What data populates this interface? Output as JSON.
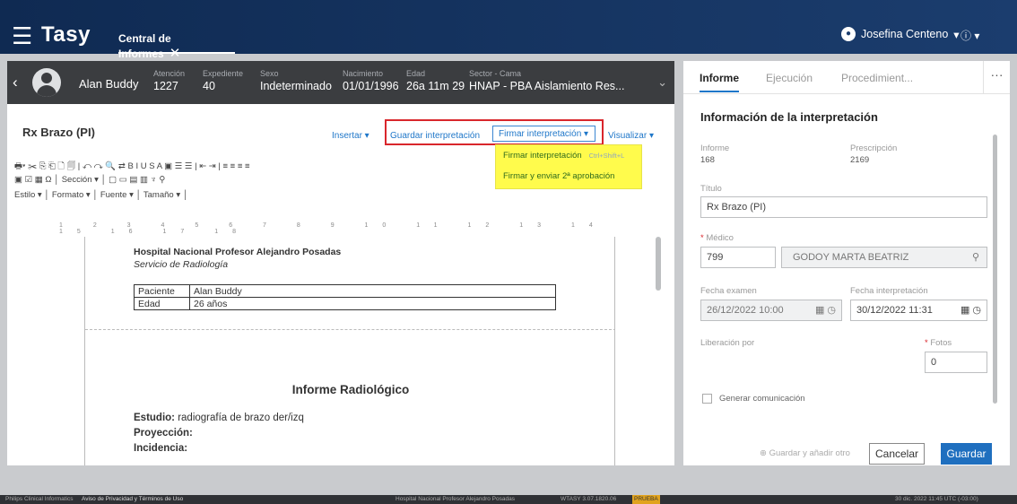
{
  "app": {
    "title": "Tasy",
    "tab": "Central de Informes"
  },
  "user": {
    "name": "Josefina Centeno"
  },
  "patient": {
    "name": "Alan Buddy",
    "fields": [
      {
        "label": "Atención",
        "value": "1227"
      },
      {
        "label": "Expediente",
        "value": "40"
      },
      {
        "label": "Sexo",
        "value": "Indeterminado"
      },
      {
        "label": "Nacimiento",
        "value": "01/01/1996"
      },
      {
        "label": "Edad",
        "value": "26a 11m 29"
      },
      {
        "label": "Sector - Cama",
        "value": "HNAP - PBA Aislamiento Res..."
      }
    ]
  },
  "editor": {
    "report_title": "Rx Brazo (PI)",
    "toolbar": {
      "insertar": "Insertar",
      "guardar": "Guardar interpretación",
      "firmar": "Firmar interpretación",
      "visualizar": "Visualizar"
    },
    "dropdown": {
      "item1": "Firmar interpretación",
      "shortcut1": "Ctrl+Shift+L",
      "item2": "Firmar y enviar 2ª aprobación"
    },
    "tool_row1": "🖶▾ ✂ ⎘ ⎗ 🗋 🗐 | ↶ ↷ 🔍 ⇄  B  I  U  S  A  ▣  ☰ ☰ | ⇤ ⇥ | ≡ ≡ ≡ ≡",
    "tool_row2": "▣ ☑ ▦ Ω │ Sección  ▾ │ ▢ ▭ ▤ ▥ ♆ ⚲",
    "tool_row3": "Estilo   ▾ │ Formato  ▾ │ Fuente   ▾ │ Tamaño  ▾ │",
    "ruler": "1 2 3 4 5 6 7 8 9 10 11 12 13 14 15 16 17 18",
    "doc": {
      "hospital": "Hospital Nacional Profesor Alejandro Posadas",
      "service": "Servicio de Radiología",
      "rows": [
        {
          "k": "Paciente",
          "v": "Alan Buddy"
        },
        {
          "k": "Edad",
          "v": "26 años"
        }
      ],
      "report_heading": "Informe Radiológico",
      "estudio_label": "Estudio:",
      "estudio_value": " radiografía de brazo der/izq",
      "proyeccion_label": "Proyección:",
      "incidencia_label": "Incidencia:"
    }
  },
  "right": {
    "tabs": [
      "Informe",
      "Ejecución",
      "Procedimient..."
    ],
    "section": "Información de la interpretación",
    "informe_label": "Informe",
    "informe_value": "168",
    "prescripcion_label": "Prescripción",
    "prescripcion_value": "2169",
    "titulo_label": "Título",
    "titulo_value": "Rx Brazo (PI)",
    "medico_label": "Médico",
    "medico_code": "799",
    "medico_name": "GODOY MARTA BEATRIZ",
    "fecha_examen_label": "Fecha examen",
    "fecha_examen_value": "26/12/2022 10:00",
    "fecha_interp_label": "Fecha interpretación",
    "fecha_interp_value": "30/12/2022 11:31",
    "liberacion_label": "Liberación por",
    "fotos_label": "Fotos",
    "fotos_value": "0",
    "generar_label": "Generar comunicación",
    "guardar_anadir": "Guardar y añadir otro",
    "cancelar": "Cancelar",
    "guardar": "Guardar"
  },
  "footer": {
    "left": "Philips Clinical Informatics",
    "privacy": "Aviso de Privacidad y Términos de Uso",
    "center": "Hospital Nacional Profesor Alejandro Posadas",
    "version": "WTASY 3.07.1820.06",
    "tag": "PRUEBA",
    "right": "30 dic. 2022   11:45   UTC (-03:00)"
  },
  "colors": {
    "header": "#1b3d6e",
    "accent": "#1f77c9",
    "highlight": "#fffb4c",
    "box": "#d9262c"
  }
}
